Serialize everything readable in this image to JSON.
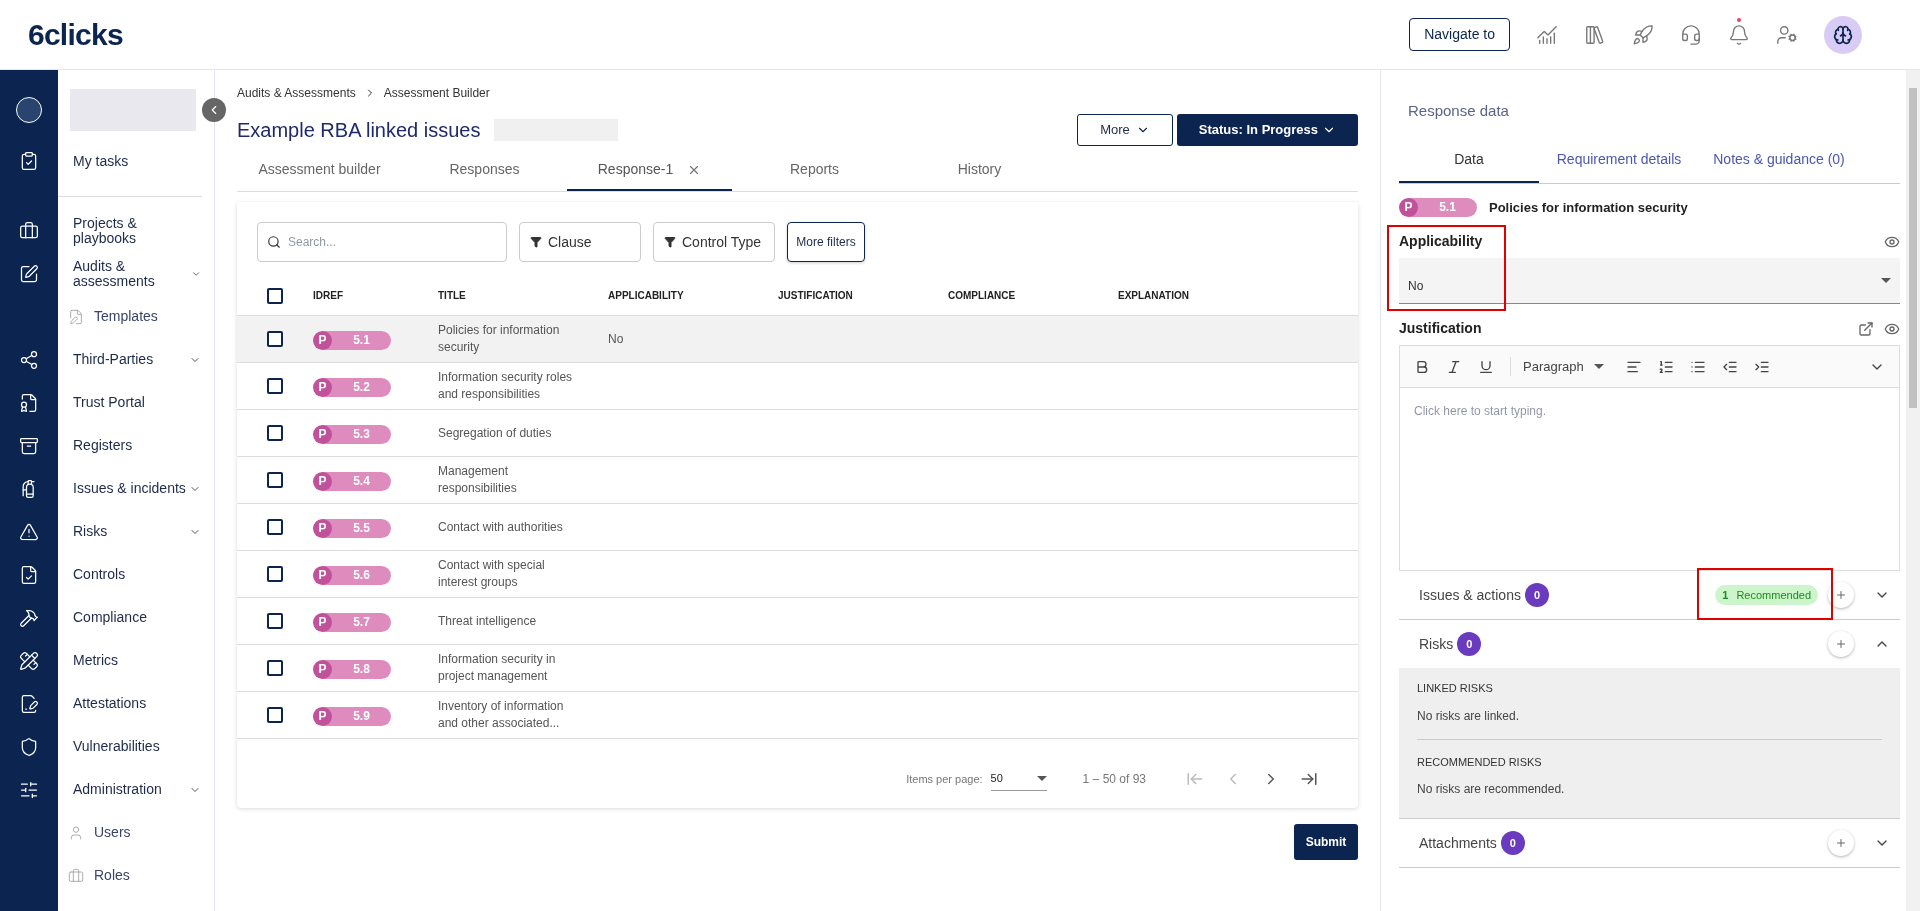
{
  "header": {
    "logo": "6clicks",
    "navigate_button": "Navigate to",
    "notification_dot": true
  },
  "sidebar": {
    "items": [
      {
        "label": "My tasks",
        "kind": "main",
        "expandable": false
      },
      {
        "label": "Projects & playbooks",
        "kind": "main",
        "expandable": false
      },
      {
        "label": "Audits & assessments",
        "kind": "main",
        "expandable": true
      },
      {
        "label": "Templates",
        "kind": "sub",
        "expandable": false
      },
      {
        "label": "Third-Parties",
        "kind": "main",
        "expandable": true
      },
      {
        "label": "Trust Portal",
        "kind": "main",
        "expandable": false
      },
      {
        "label": "Registers",
        "kind": "main",
        "expandable": false
      },
      {
        "label": "Issues & incidents",
        "kind": "main",
        "expandable": true
      },
      {
        "label": "Risks",
        "kind": "main",
        "expandable": true
      },
      {
        "label": "Controls",
        "kind": "main",
        "expandable": false
      },
      {
        "label": "Compliance",
        "kind": "main",
        "expandable": false
      },
      {
        "label": "Metrics",
        "kind": "main",
        "expandable": false
      },
      {
        "label": "Attestations",
        "kind": "main",
        "expandable": false
      },
      {
        "label": "Vulnerabilities",
        "kind": "main",
        "expandable": false
      },
      {
        "label": "Administration",
        "kind": "main",
        "expandable": true
      },
      {
        "label": "Users",
        "kind": "sub",
        "expandable": false
      },
      {
        "label": "Roles",
        "kind": "sub",
        "expandable": false
      }
    ]
  },
  "breadcrumb": [
    "Audits & Assessments",
    "Assessment Builder"
  ],
  "page_title": "Example RBA linked issues",
  "more_button": "More",
  "status_button": "Status: In Progress",
  "tabs": [
    {
      "label": "Assessment builder",
      "selected": false,
      "closable": false
    },
    {
      "label": "Responses",
      "selected": false,
      "closable": false
    },
    {
      "label": "Response-1",
      "selected": true,
      "closable": true
    },
    {
      "label": "Reports",
      "selected": false,
      "closable": false
    },
    {
      "label": "History",
      "selected": false,
      "closable": false
    }
  ],
  "filters": {
    "search_placeholder": "Search...",
    "clause": "Clause",
    "control_type": "Control Type",
    "more_filters": "More filters"
  },
  "table": {
    "select_all_checked": false,
    "columns": [
      "IDREF",
      "TITLE",
      "APPLICABILITY",
      "JUSTIFICATION",
      "COMPLIANCE",
      "EXPLANATION"
    ],
    "rows": [
      {
        "prefix": "P",
        "idref": "5.1",
        "title": "Policies for information security",
        "applicability": "No",
        "selected": true,
        "checked": false
      },
      {
        "prefix": "P",
        "idref": "5.2",
        "title": "Information security roles and responsibilities",
        "applicability": "",
        "selected": false,
        "checked": false
      },
      {
        "prefix": "P",
        "idref": "5.3",
        "title": "Segregation of duties",
        "applicability": "",
        "selected": false,
        "checked": false
      },
      {
        "prefix": "P",
        "idref": "5.4",
        "title": "Management responsibilities",
        "applicability": "",
        "selected": false,
        "checked": false
      },
      {
        "prefix": "P",
        "idref": "5.5",
        "title": "Contact with authorities",
        "applicability": "",
        "selected": false,
        "checked": false
      },
      {
        "prefix": "P",
        "idref": "5.6",
        "title": "Contact with special interest groups",
        "applicability": "",
        "selected": false,
        "checked": false
      },
      {
        "prefix": "P",
        "idref": "5.7",
        "title": "Threat intelligence",
        "applicability": "",
        "selected": false,
        "checked": false
      },
      {
        "prefix": "P",
        "idref": "5.8",
        "title": "Information security in project management",
        "applicability": "",
        "selected": false,
        "checked": false
      },
      {
        "prefix": "P",
        "idref": "5.9",
        "title": "Inventory of information and other associated...",
        "applicability": "",
        "selected": false,
        "checked": false
      }
    ]
  },
  "pagination": {
    "items_per_page_label": "Items per page:",
    "items_per_page": "50",
    "range": "1 – 50 of 93"
  },
  "submit_button": "Submit",
  "response_panel": {
    "title": "Response data",
    "tabs": [
      {
        "label": "Data",
        "selected": true
      },
      {
        "label": "Requirement details",
        "selected": false
      },
      {
        "label": "Notes & guidance (0)",
        "selected": false
      }
    ],
    "requirement": {
      "prefix": "P",
      "idref": "5.1",
      "title": "Policies for information security"
    },
    "applicability": {
      "label": "Applicability",
      "value": "No",
      "highlighted": true
    },
    "justification": {
      "label": "Justification",
      "paragraph": "Paragraph",
      "placeholder": "Click here to start typing."
    },
    "sections": [
      {
        "label": "Issues & actions",
        "count": "0",
        "recommended_count": "1",
        "recommended_label": "Recommended",
        "recommended_highlighted": true,
        "expanded": false
      },
      {
        "label": "Risks",
        "count": "0",
        "expanded": true,
        "groups": [
          {
            "heading": "LINKED RISKS",
            "text": "No risks are linked."
          },
          {
            "heading": "RECOMMENDED RISKS",
            "text": "No risks are recommended."
          }
        ]
      },
      {
        "label": "Attachments",
        "count": "0",
        "expanded": false
      }
    ]
  }
}
